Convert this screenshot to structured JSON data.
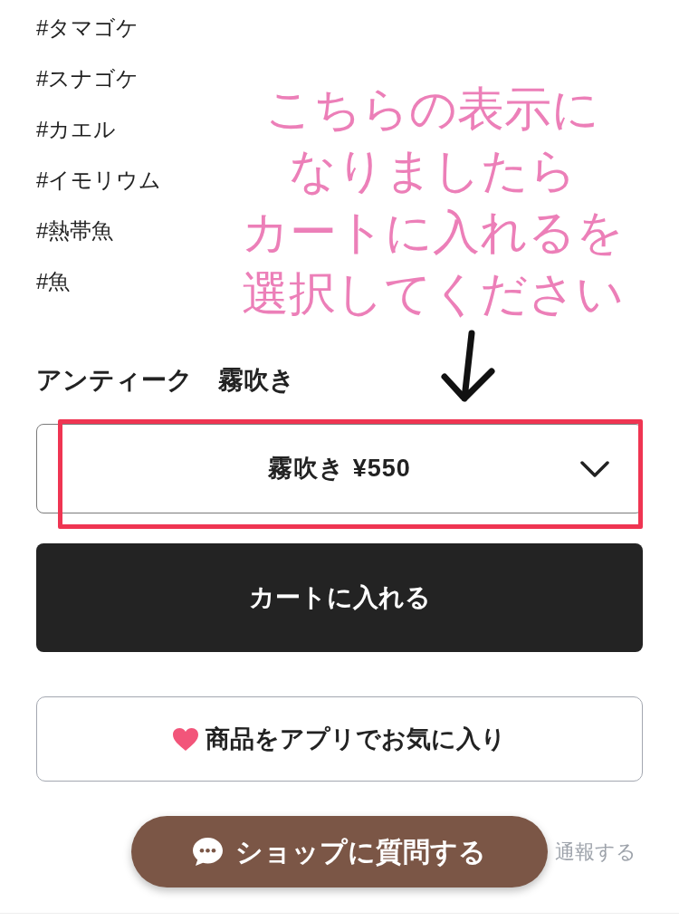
{
  "tags": [
    "#タマゴケ",
    "#スナゴケ",
    "#カエル",
    "#イモリウム",
    "#熱帯魚",
    "#魚"
  ],
  "annotation": {
    "lines": [
      "こちらの表示に",
      "なりましたら",
      "カートに入れるを",
      "選択してください"
    ]
  },
  "variant": {
    "label": "アンティーク　霧吹き",
    "selected_option": "霧吹き ¥550"
  },
  "actions": {
    "add_to_cart": "カートに入れる",
    "favorite": "商品をアプリでお気に入り",
    "ask_shop": "ショップに質問する",
    "report": "通報する"
  }
}
